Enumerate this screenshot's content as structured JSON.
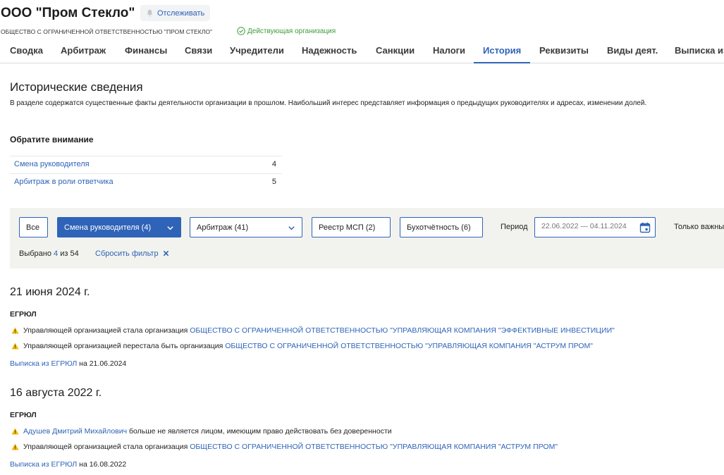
{
  "header": {
    "company_title": "ООО \"Пром Стекло\"",
    "watch_label": "Отслеживать",
    "full_name": "ОБЩЕСТВО С ОГРАНИЧЕННОЙ ОТВЕТСТВЕННОСТЬЮ \"ПРОМ СТЕКЛО\"",
    "status": "Действующая организация"
  },
  "tabs": [
    {
      "label": "Сводка"
    },
    {
      "label": "Арбитраж"
    },
    {
      "label": "Финансы"
    },
    {
      "label": "Связи"
    },
    {
      "label": "Учредители"
    },
    {
      "label": "Надежность"
    },
    {
      "label": "Санкции"
    },
    {
      "label": "Налоги"
    },
    {
      "label": "История",
      "active": true
    },
    {
      "label": "Реквизиты"
    },
    {
      "label": "Виды деят."
    },
    {
      "label": "Выписка из"
    }
  ],
  "section": {
    "title": "Исторические сведения",
    "description": "В разделе содержатся существенные факты деятельности организации в прошлом. Наибольший интерес представляет информация о предыдущих руководителях и адресах, изменении долей."
  },
  "notes": {
    "title": "Обратите внимание",
    "items": [
      {
        "label": "Смена руководителя",
        "count": "4"
      },
      {
        "label": "Арбитраж в роли ответчика",
        "count": "5"
      }
    ]
  },
  "filters": {
    "all": "Все",
    "director_change": "Смена руководителя (4)",
    "arbitration": "Арбитраж (41)",
    "msp_registry": "Реестр МСП (2)",
    "accounting": "Бухотчётность (6)",
    "period_label": "Период",
    "period_placeholder": "22.06.2022 — 04.11.2024",
    "only_important": "Только важные",
    "selected_prefix": "Выбрано",
    "selected_count": "4",
    "selected_of": "из 54",
    "reset": "Сбросить фильтр"
  },
  "events": [
    {
      "date": "21 июня 2024 г.",
      "source": "ЕГРЮЛ",
      "lines": [
        {
          "text": "Управляющей организацией стала организация ",
          "link": "ОБЩЕСТВО С ОГРАНИЧЕННОЙ ОТВЕТСТВЕННОСТЬЮ \"УПРАВЛЯЮЩАЯ КОМПАНИЯ \"ЭФФЕКТИВНЫЕ ИНВЕСТИЦИИ\""
        },
        {
          "text": "Управляющей организацией перестала быть организация ",
          "link": "ОБЩЕСТВО С ОГРАНИЧЕННОЙ ОТВЕТСТВЕННОСТЬЮ \"УПРАВЛЯЮЩАЯ КОМПАНИЯ \"АСТРУМ ПРОМ\""
        }
      ],
      "footer_link": "Выписка из ЕГРЮЛ",
      "footer_text": " на 21.06.2024"
    },
    {
      "date": "16 августа 2022 г.",
      "source": "ЕГРЮЛ",
      "lines": [
        {
          "person": "Адушев Дмитрий Михайлович",
          "text_after": " больше не является лицом, имеющим право действовать без доверенности"
        },
        {
          "text": "Управляющей организацией стала организация ",
          "link": "ОБЩЕСТВО С ОГРАНИЧЕННОЙ ОТВЕТСТВЕННОСТЬЮ \"УПРАВЛЯЮЩАЯ КОМПАНИЯ \"АСТРУМ ПРОМ\""
        }
      ],
      "footer_link": "Выписка из ЕГРЮЛ",
      "footer_text": " на 16.08.2022"
    }
  ],
  "colors": {
    "accent": "#2f63b8",
    "status_green": "#3c9b3c",
    "warning": "#f2b705",
    "filter_bg": "#f2f3ee"
  },
  "icons": [
    "bell-icon",
    "check-circle-icon",
    "chevron-down-icon",
    "calendar-icon",
    "close-icon",
    "warning-icon"
  ]
}
